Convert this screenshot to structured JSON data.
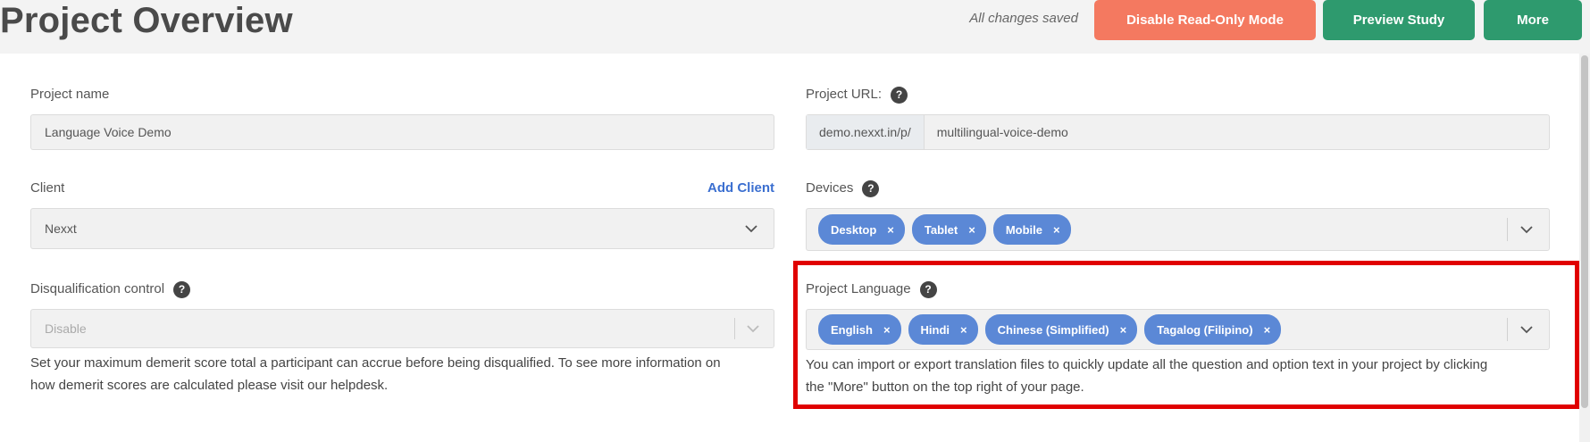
{
  "header": {
    "title": "Project Overview",
    "save_status": "All changes saved",
    "disable_readonly_label": "Disable Read-Only Mode",
    "preview_label": "Preview Study",
    "more_label": "More"
  },
  "form": {
    "project_name": {
      "label": "Project name",
      "value": "Language Voice Demo"
    },
    "project_url": {
      "label": "Project URL:",
      "help": "?",
      "prefix": "demo.nexxt.in/p/",
      "value": "multilingual-voice-demo"
    },
    "client": {
      "label": "Client",
      "add_label": "Add Client",
      "value": "Nexxt"
    },
    "devices": {
      "label": "Devices",
      "help": "?",
      "tags": [
        "Desktop",
        "Tablet",
        "Mobile"
      ],
      "remove_glyph": "×"
    },
    "disqualification": {
      "label": "Disqualification control",
      "help": "?",
      "value": "Disable",
      "help_line1": "Set your maximum demerit score total a participant can accrue before being disqualified. To see more information on",
      "help_line2": "how demerit scores are calculated please visit our helpdesk."
    },
    "project_language": {
      "label": "Project Language",
      "help": "?",
      "tags": [
        "English",
        "Hindi",
        "Chinese (Simplified)",
        "Tagalog (Filipino)"
      ],
      "remove_glyph": "×",
      "help_line1": "You can import or export translation files to quickly update all the question and option text in your project by clicking",
      "help_line2": "the \"More\" button on the top right of your page."
    }
  },
  "icons": {
    "help": "question-circle-icon",
    "dropdown": "chevron-down-icon",
    "remove": "close-icon"
  },
  "colors": {
    "disable_button": "#f47960",
    "preview_button": "#2e9a6e",
    "more_button": "#2e9a6e",
    "tag": "#5b88d6",
    "link": "#3b6fd0",
    "highlight": "#e00000"
  }
}
